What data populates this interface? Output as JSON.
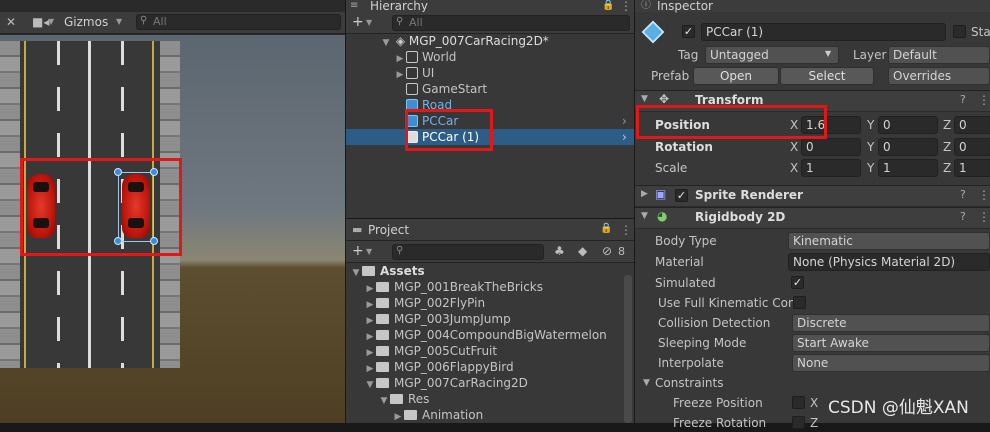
{
  "scene": {
    "gizmos_label": "Gizmos",
    "search_placeholder": "All"
  },
  "hierarchy": {
    "tab_label": "Hierarchy",
    "search_placeholder": "All",
    "scene_name": "MGP_007CarRacing2D*",
    "items": [
      {
        "label": "World",
        "has_children": true
      },
      {
        "label": "UI",
        "has_children": true
      },
      {
        "label": "GameStart",
        "has_children": false
      },
      {
        "label": "Road",
        "has_children": false
      },
      {
        "label": "PCCar",
        "has_children": false
      },
      {
        "label": "PCCar (1)",
        "has_children": false,
        "selected": true
      }
    ]
  },
  "project": {
    "tab_label": "Project",
    "hidden_count": "8",
    "assets_label": "Assets",
    "folders": [
      "MGP_001BreakTheBricks",
      "MGP_002FlyPin",
      "MGP_003JumpJump",
      "MGP_004CompoundBigWatermelon",
      "MGP_005CutFruit",
      "MGP_006FlappyBird",
      "MGP_007CarRacing2D"
    ],
    "subfolder": "Res",
    "subsubfolder": "Animation"
  },
  "inspector": {
    "tab_label": "Inspector",
    "object_name": "PCCar (1)",
    "static_label": "Sta",
    "tag_label": "Tag",
    "tag_value": "Untagged",
    "layer_label": "Layer",
    "layer_value": "Default",
    "prefab_label": "Prefab",
    "open_label": "Open",
    "select_label": "Select",
    "overrides_label": "Overrides",
    "transform": {
      "title": "Transform",
      "position_label": "Position",
      "rotation_label": "Rotation",
      "scale_label": "Scale",
      "x_label": "X",
      "y_label": "Y",
      "z_label": "Z",
      "position": {
        "x": "1.6",
        "y": "0",
        "z": "0"
      },
      "rotation": {
        "x": "0",
        "y": "0",
        "z": "0"
      },
      "scale": {
        "x": "1",
        "y": "1",
        "z": "1"
      }
    },
    "sprite_renderer_title": "Sprite Renderer",
    "rigidbody": {
      "title": "Rigidbody 2D",
      "body_type_label": "Body Type",
      "body_type_value": "Kinematic",
      "material_label": "Material",
      "material_value": "None (Physics Material 2D)",
      "simulated_label": "Simulated",
      "use_full_kinematic_label": "Use Full Kinematic Cont",
      "collision_label": "Collision Detection",
      "collision_value": "Discrete",
      "sleeping_label": "Sleeping Mode",
      "sleeping_value": "Start Awake",
      "interpolate_label": "Interpolate",
      "interpolate_value": "None",
      "constraints_label": "Constraints",
      "freeze_position_label": "Freeze Position",
      "freeze_rotation_label": "Freeze Rotation",
      "x_label": "X",
      "z_label": "Z"
    }
  },
  "watermark": "CSDN @仙魁XAN",
  "colors": {
    "highlight_box": "#e01818",
    "selection": "#2c5d87",
    "blue_text": "#6cb4ee"
  }
}
